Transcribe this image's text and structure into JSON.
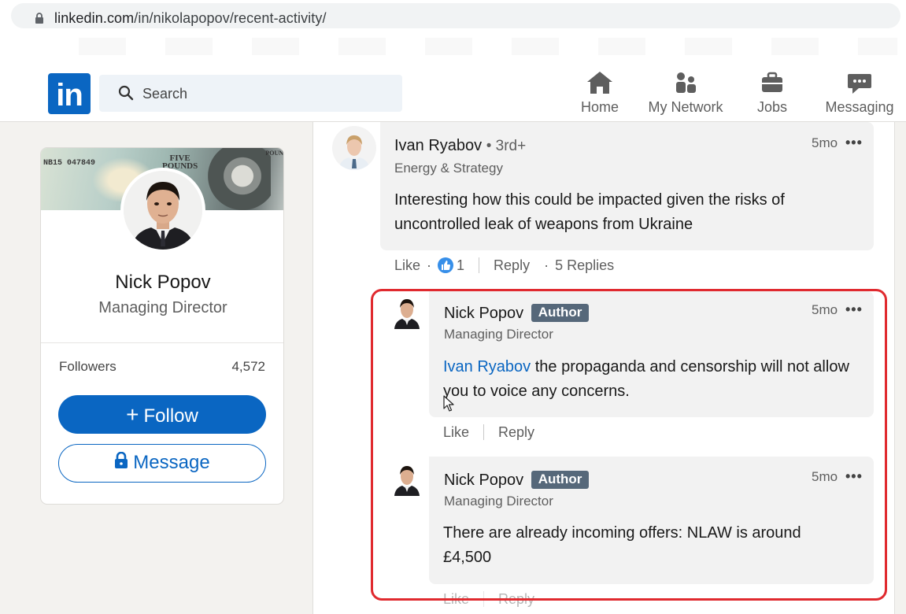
{
  "browser": {
    "url_host": "linkedin.com",
    "url_path": "/in/nikolapopov/recent-activity/"
  },
  "nav": {
    "logo": "in",
    "search_placeholder": "Search",
    "items": [
      {
        "label": "Home",
        "icon": "home-icon"
      },
      {
        "label": "My Network",
        "icon": "network-icon"
      },
      {
        "label": "Jobs",
        "icon": "briefcase-icon"
      },
      {
        "label": "Messaging",
        "icon": "chat-icon"
      }
    ]
  },
  "profile": {
    "banner": {
      "serial": "NB15 047849",
      "five": "FIVE",
      "pounds": "POUNDS",
      "pounds_right": "POUN"
    },
    "name": "Nick Popov",
    "title": "Managing Director",
    "followers_label": "Followers",
    "followers_count": "4,572",
    "follow_label": "Follow",
    "message_label": "Message"
  },
  "comments": [
    {
      "name": "Ivan Ryabov",
      "degree": "• 3rd+",
      "subtitle": "Energy & Strategy",
      "time": "5mo",
      "more": "•••",
      "text": "Interesting how this could be impacted given the risks of uncontrolled leak of weapons from Ukraine",
      "like_label": "Like",
      "like_count": "1",
      "reply_label": "Reply",
      "replies_label": "5 Replies",
      "separator_dot": "·"
    },
    {
      "name": "Nick Popov",
      "badge": "Author",
      "subtitle": "Managing Director",
      "time": "5mo",
      "more": "•••",
      "mention": "Ivan Ryabov",
      "text": "the propaganda and censorship will not allow you to voice any concerns.",
      "like_label": "Like",
      "reply_label": "Reply"
    },
    {
      "name": "Nick Popov",
      "badge": "Author",
      "subtitle": "Managing Director",
      "time": "5mo",
      "more": "•••",
      "text": "There are already incoming offers: NLAW is around £4,500",
      "like_label": "Like",
      "reply_label": "Reply"
    }
  ],
  "colors": {
    "brand": "#0a66c2",
    "highlight": "#e02a2f",
    "author_badge": "#56687a"
  }
}
